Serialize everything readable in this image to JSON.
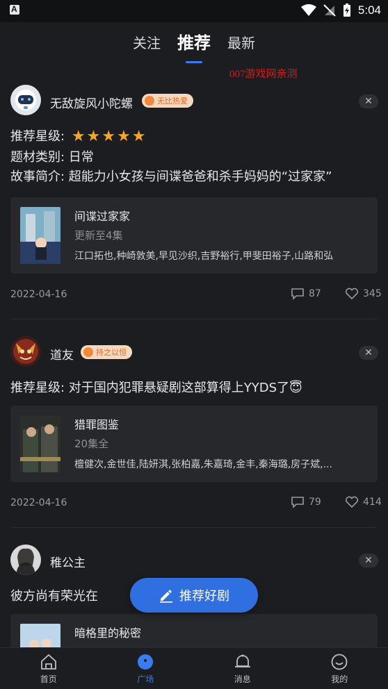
{
  "status_bar": {
    "time": "5:04"
  },
  "tabs": [
    {
      "label": "关注"
    },
    {
      "label": "推荐"
    },
    {
      "label": "最新"
    }
  ],
  "watermark": "007游戏网亲测",
  "posts": [
    {
      "username": "无敌旋风小陀螺",
      "badge": "无比热爱",
      "rating_label": "推荐星级:",
      "rating_stars": 5,
      "genre": "题材类别: 日常",
      "synopsis": "故事简介: 超能力小女孩与间谍爸爸和杀手妈妈的“过家家”",
      "card": {
        "title": "间谍过家家",
        "subtitle": "更新至4集",
        "cast": "江口拓也,种崎敦美,早见沙织,吉野裕行,甲斐田裕子,山路和弘"
      },
      "date": "2022-04-16",
      "comments": "87",
      "likes": "345"
    },
    {
      "username": "道友",
      "badge": "持之以恒",
      "text": "推荐星级: 对于国内犯罪悬疑剧这部算得上YYDS了😇",
      "card": {
        "title": "猎罪图鉴",
        "subtitle": "20集全",
        "cast": "檀健次,金世佳,陆妍淇,张柏嘉,朱嘉琦,金丰,秦海璐,房子斌,..."
      },
      "date": "2022-04-16",
      "comments": "79",
      "likes": "414"
    },
    {
      "username": "稚公主",
      "text": "彼方尚有荣光在",
      "card": {
        "title": "暗格里的秘密"
      }
    }
  ],
  "fab": {
    "label": "推荐好剧"
  },
  "bottom_nav": [
    {
      "label": "首页"
    },
    {
      "label": "广场"
    },
    {
      "label": "消息"
    },
    {
      "label": "我的"
    }
  ],
  "colors": {
    "accent": "#2f6fe0",
    "badge_text": "#e36a22",
    "star": "#f6a623"
  }
}
